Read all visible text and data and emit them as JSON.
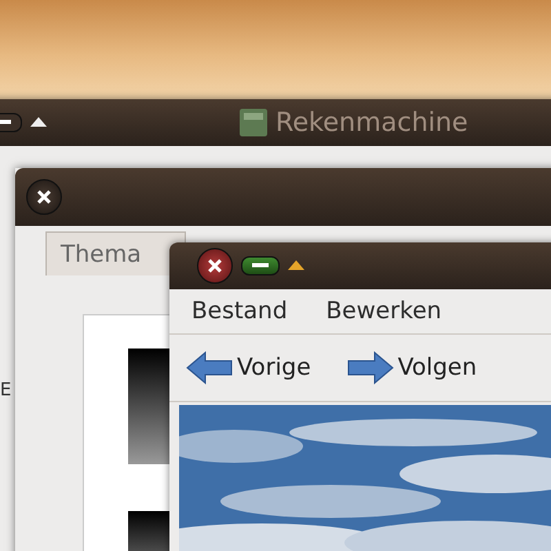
{
  "windows": [
    {
      "kind": "calculator",
      "title": "Rekenmachine",
      "side_label": "E"
    },
    {
      "kind": "appearance",
      "tabs": [
        {
          "label": "Thema",
          "selected": true
        }
      ]
    },
    {
      "kind": "viewer",
      "menu": [
        "Bestand",
        "Bewerken"
      ],
      "toolbar": [
        {
          "label": "Vorige",
          "kind": "back"
        },
        {
          "label": "Volgen",
          "kind": "forward"
        }
      ],
      "image": {
        "kind": "picture"
      }
    }
  ]
}
